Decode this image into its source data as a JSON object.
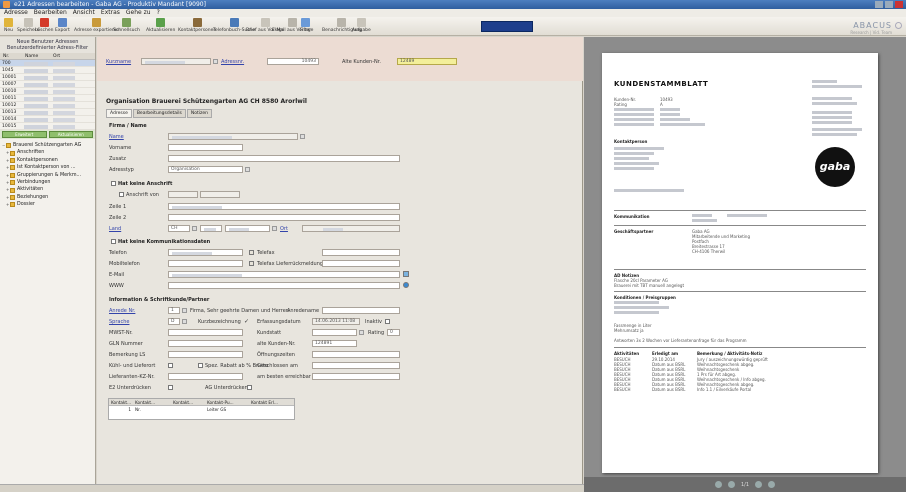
{
  "window": {
    "title": "e21 Adressen bearbeiten - Gaba AG - Produktiv Mandant [9090]"
  },
  "menu": [
    "Adresse",
    "Bearbeiten",
    "Ansicht",
    "Extras",
    "Gehe zu",
    "?"
  ],
  "toolbar": {
    "items": [
      {
        "label": "Neu",
        "icon": "new-icon",
        "color": "#e0b43a"
      },
      {
        "label": "Speichern",
        "icon": "save-icon",
        "color": "#c6c2b8"
      },
      {
        "label": "Löschen",
        "icon": "delete-icon",
        "color": "#d43a2a"
      },
      {
        "label": "Export",
        "icon": "export-icon",
        "color": "#5b86c8"
      },
      {
        "label": "Adresse exportieren",
        "icon": "address-export-icon",
        "color": "#c99a3a"
      },
      {
        "label": "Schnellsuch",
        "icon": "quick-search-icon",
        "color": "#7aa05a"
      },
      {
        "label": "Aktualisieren",
        "icon": "refresh-icon",
        "color": "#5aa04a"
      },
      {
        "label": "Kontaktpersonen",
        "icon": "contacts-icon",
        "color": "#8a6a3a"
      },
      {
        "label": "Telefonbuch-Suche",
        "icon": "phonebook-icon",
        "color": "#4a7ab8"
      },
      {
        "label": "Brief aus Vorlage",
        "icon": "letter-icon",
        "color": "#c8c4ba"
      },
      {
        "label": "E-Mail aus Vorlage",
        "icon": "email-icon",
        "color": "#b8b4aa"
      },
      {
        "label": "Filter",
        "icon": "filter-icon",
        "color": "#6a9ad8"
      },
      {
        "label": "Benachrichtigung",
        "icon": "notification-icon",
        "color": "#b8b4aa"
      },
      {
        "label": "Aufgabe",
        "icon": "task-icon",
        "color": "#c8c4ba"
      }
    ]
  },
  "brand": {
    "name": "ABACUS",
    "sub": "Research | Vid. Team"
  },
  "left": {
    "header_line1": "Neue Benutzer Adressen",
    "header_line2": "Benutzerdefinierter Adress-Filter",
    "col_nr": "Nr.",
    "col_name": "Name",
    "col_ort": "Ort",
    "rows": [
      "700",
      "1045",
      "10001",
      "10007",
      "10010",
      "10011",
      "10012",
      "10013",
      "10014",
      "10015"
    ],
    "btn_left": "Erweitert",
    "btn_right": "Aktualisieren",
    "tree_root": "Brauerei Schützengarten AG",
    "tree": [
      "Anschriften",
      "Kontaktpersonen",
      "Ist Kontaktperson von ...",
      "Gruppierungen & Merkm...",
      "Verbindungen",
      "Aktivitäten",
      "Beziehungen",
      "Dossier"
    ]
  },
  "form": {
    "top_kurzname": "Kurzname",
    "top_adressnr": "Adressnr.",
    "top_adressnr_val": "10493",
    "top_alte": "Alte Kunden-Nr.",
    "top_alte_val": "12489",
    "org_title": "Organisation Brauerei Schützengarten AG CH 8580 Arorlwil",
    "tabs": [
      "Adresse",
      "Bearbeitungsdetails",
      "Notizen"
    ],
    "sec_firma": "Firma / Name",
    "f_name": "Name",
    "f_vorname": "Vorname",
    "f_zusatz": "Zusatz",
    "f_adresstyp": "Adresstyp",
    "f_adresstyp_val": "Organisation",
    "sec_anschrift": "Hat keine Anschrift",
    "f_anschrift_von": "Anschrift von",
    "f_zeile1": "Zeile 1",
    "f_zeile2": "Zeile 2",
    "f_land": "Land",
    "f_land_val": "CH",
    "f_ort_lbl": "Ort",
    "sec_komm": "Hat keine Kommunikationsdaten",
    "f_telefon": "Telefon",
    "f_telefax": "Telefax",
    "f_mobil": "Mobiltelefon",
    "f_telefax_lief": "Telefax Lieferrückmeldung",
    "f_email": "E-Mail",
    "f_www": "WWW",
    "sec_info": "Information & Schriftkunde/Partner",
    "f_anrede": "Anrede Nr.",
    "f_anrede_val": "1",
    "f_anrede_txt": "Firma, Sehr geehrte Damen und Herren",
    "f_anredename": "Anredename",
    "f_sprache": "Sprache",
    "f_sprache_val": "D",
    "f_kurzbez": "Kurzbezeichnung",
    "f_erfasst": "Erfassungsdatum",
    "f_erfasst_val": "14.06.2013 11:08",
    "f_inaktiv": "Inaktiv",
    "f_mwst": "MWST-Nr.",
    "f_kundstat": "Kundstatt",
    "f_rating": "Rating",
    "f_rating_val": "0",
    "f_glnnummer": "GLN Nummer",
    "f_altekunde": "alte Kunden-Nr.",
    "f_altekunde_val": "124891",
    "f_bemerkung": "Bemerkung LS",
    "f_oeffnung": "Öffnungszeiten",
    "f_kuehl": "Kühl- und Lieferort",
    "f_spez": "Spez. Rabatt ab % Brutto",
    "f_geschlossen": "Geschlossen am",
    "f_lieferanten": "Lieferanten-KZ-Nr.",
    "f_erreichbar": "am besten erreichbar",
    "f_e2": "E2 Unterdrücken",
    "f_ag": "AG Unterdrücken",
    "grid_head": [
      "Kontakt...",
      "Kontakt...",
      "Kontakt...",
      "Kontakt-Pu...",
      "Kontakt Erl..."
    ],
    "grid_row": [
      "1",
      "Nr.",
      "",
      "Leiter GS",
      ""
    ]
  },
  "preview": {
    "title": "KUNDENSTAMMBLATT",
    "kunden_nr_lbl": "Kunden-Nr.",
    "kunden_nr": "10493",
    "rating_lbl": "Rating",
    "rating": "A",
    "l_ansprech": "Kontaktperson",
    "l_kommu": "Kommunikation",
    "l_geschaeft": "Geschäftspartner",
    "partner_name": "Gaba AG",
    "partner_l2": "Mitarbeitende und Marketing",
    "partner_l3": "Postfach",
    "partner_l4": "Breitestrasse 17",
    "partner_l5": "CH-4106 Therwil",
    "l_notizen": "AD Notizen",
    "notiz1": "Flasche 20cl Parameter AG",
    "notiz2": "Brauerei mit TBT manuell angelegt",
    "l_konditionen": "Konditionen / Preisgruppen",
    "fw1": "Fassmenge in Liter",
    "fw2": "Mehrumsatz ja",
    "notiz3": "Antworten 3x 2 Wochen vor Lieferantenanfrage für das Programm",
    "l_aktivitaet": "Aktivitäten",
    "l_erledigt": "Erledigt am",
    "l_bemerkung": "Bemerkung / Aktivitäts-Notiz",
    "acts": [
      {
        "t": "BESUCH",
        "d": "29.10.2014",
        "n": "Jury / auszeichnungswürdig geprüft"
      },
      {
        "t": "BESUCH",
        "d": "Datum aus BSRL",
        "n": "Weihnachtsgeschenk abgeg."
      },
      {
        "t": "BESUCH",
        "d": "Datum aus BSRL",
        "n": "Weihnachtsgeschenk"
      },
      {
        "t": "BESUCH",
        "d": "Datum aus BSRL",
        "n": "1 Prs für Art abgeg."
      },
      {
        "t": "BESUCH",
        "d": "Datum aus BSRL",
        "n": "Weihnachtsgeschenk / Info abgeg."
      },
      {
        "t": "BESUCH",
        "d": "Datum aus BSRL",
        "n": "Weihnachtsgeschenk abgeg."
      },
      {
        "t": "BESUCH",
        "d": "Datum aus BSRL",
        "n": "Info 1.1 / Eilverkäufe Portal"
      }
    ],
    "logo": "gaba",
    "page_indicator": "1/1"
  }
}
